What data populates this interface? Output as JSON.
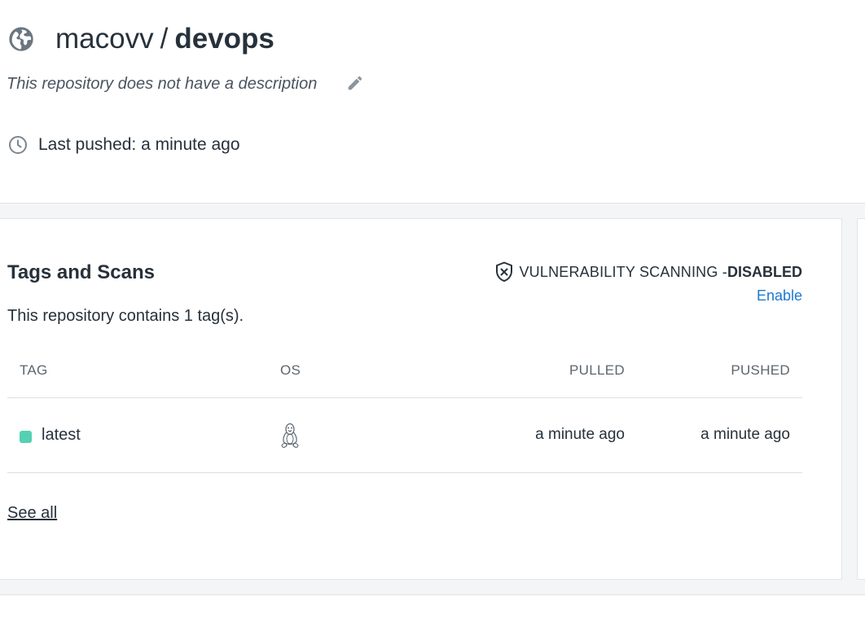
{
  "repo": {
    "owner": "macovv",
    "separator": "/",
    "name": "devops",
    "description": "This repository does not have a description",
    "last_pushed": "Last pushed: a minute ago"
  },
  "tags_card": {
    "title": "Tags and Scans",
    "vuln_label": "VULNERABILITY SCANNING - ",
    "vuln_status": "DISABLED",
    "enable_label": "Enable",
    "tag_count_text": "This repository contains 1 tag(s).",
    "columns": {
      "tag": "TAG",
      "os": "OS",
      "pulled": "PULLED",
      "pushed": "PUSHED"
    },
    "rows": [
      {
        "tag": "latest",
        "os_icon": "linux-icon",
        "pulled": "a minute ago",
        "pushed": "a minute ago",
        "status_color": "#55d0b1"
      }
    ],
    "see_all_label": "See all"
  },
  "colors": {
    "accent_link": "#1f78d1",
    "text": "#27313b",
    "page_gray": "#f4f5f7"
  }
}
